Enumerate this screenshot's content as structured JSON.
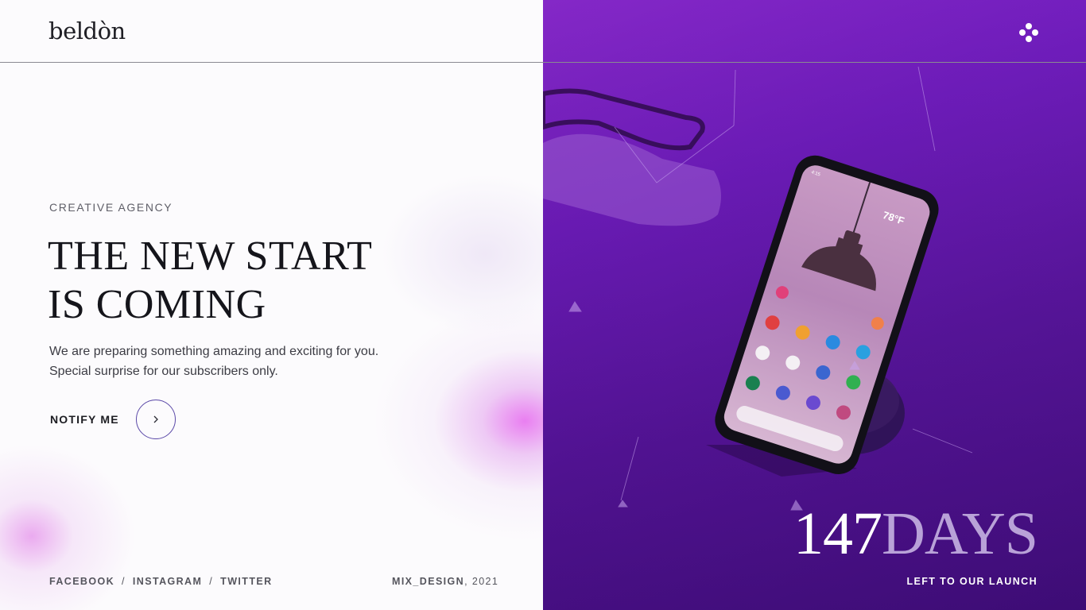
{
  "brand": {
    "logo": "beldòn"
  },
  "hero": {
    "eyebrow": "CREATIVE AGENCY",
    "headline_line1": "THE NEW START",
    "headline_line2": "IS COMING",
    "description_line1": "We are preparing something amazing and exciting for you.",
    "description_line2": "Special surprise for our subscribers only.",
    "cta_label": "NOTIFY ME",
    "cta_icon": "chevron-right-icon"
  },
  "footer": {
    "socials": [
      "FACEBOOK",
      "INSTAGRAM",
      "TWITTER"
    ],
    "separator": "/",
    "credit_name": "MIX_DESIGN",
    "credit_year": ", 2021"
  },
  "countdown": {
    "value": "147",
    "unit": "DAYS",
    "caption": "LEFT TO OUR LAUNCH"
  },
  "phone_screen": {
    "temperature": "78°F",
    "status_time": "4:15"
  },
  "menu": {
    "icon": "dots-menu-icon"
  },
  "colors": {
    "accent": "#5b49a8",
    "right_panel": "#6a1ab8",
    "glow": "#e878f0"
  }
}
